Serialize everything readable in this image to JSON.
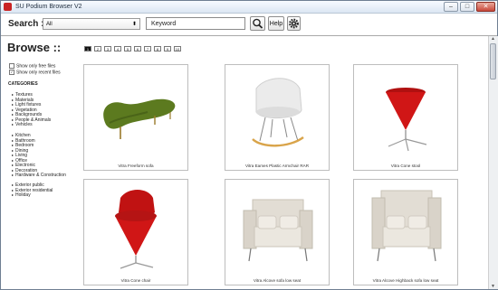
{
  "window": {
    "title": "SU Podium Browser V2"
  },
  "toolbar": {
    "search_label": "Search ::",
    "category_select": "All",
    "keyword": "Keyword",
    "help_label": "Help"
  },
  "sidebar": {
    "heading": "Browse ::",
    "show_free": "Show only free files",
    "show_recent": "Show only recent files",
    "categories_heading": "CATEGORIES",
    "group1": [
      "Textures",
      "Materials",
      "Light fixtures",
      "Vegetation",
      "Backgrounds",
      "People & Animals",
      "Vehicles"
    ],
    "group2": [
      "Kitchen",
      "Bathroom",
      "Bedroom",
      "Dining",
      "Living",
      "Office",
      "Electronic",
      "Decoration",
      "Hardware & Construction"
    ],
    "group3": [
      "Exterior public",
      "Exterior residential",
      "Holiday"
    ]
  },
  "pages": [
    "1",
    "2",
    "3",
    "4",
    "5",
    "6",
    "7",
    "8",
    "9",
    "10"
  ],
  "items": [
    {
      "caption": "Vitra Freeform sofa"
    },
    {
      "caption": "Vitra Eames Plastic Armchair RAR"
    },
    {
      "caption": "Vitra Cone stool"
    },
    {
      "caption": "Vitra Cone chair"
    },
    {
      "caption": "Vitra Alcove sofa low seat"
    },
    {
      "caption": "Vitra Alcove Highback sofa low seat"
    }
  ],
  "colors": {
    "accent_red": "#d01616",
    "sofa_green": "#5c7a1f"
  }
}
